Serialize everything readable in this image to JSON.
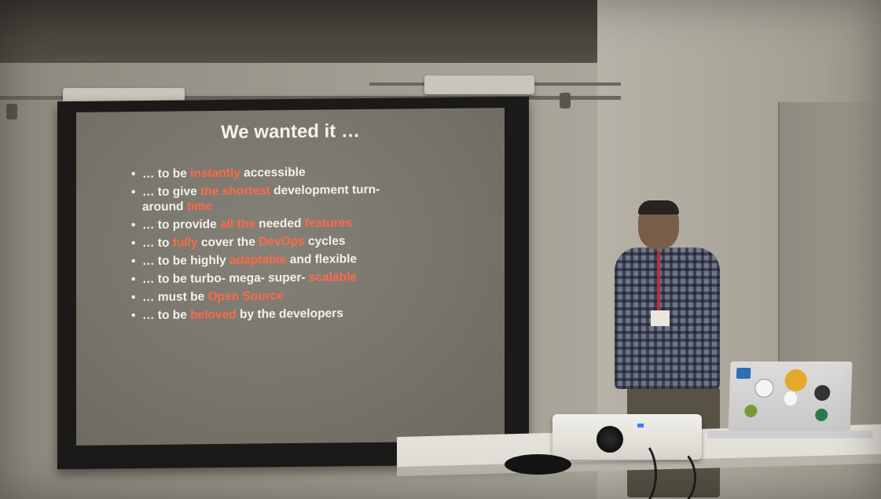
{
  "slide": {
    "title": "We wanted it …",
    "bullets": [
      {
        "parts": [
          "… to be ",
          "instantly",
          " accessible"
        ]
      },
      {
        "parts": [
          "… to give ",
          "the shortest",
          " development turn-around ",
          "time"
        ]
      },
      {
        "parts": [
          "… to provide ",
          "all the",
          " needed ",
          "features"
        ]
      },
      {
        "parts": [
          "… to ",
          "fully",
          " cover the ",
          "DevOps",
          " cycles"
        ]
      },
      {
        "parts": [
          "… to be highly ",
          "adaptable",
          " and flexible"
        ]
      },
      {
        "parts": [
          "… to be turbo- mega- super- ",
          "scalable"
        ]
      },
      {
        "parts": [
          "… must be ",
          "Open Source"
        ]
      },
      {
        "parts": [
          "… to be ",
          "beloved",
          " by the developers"
        ]
      }
    ]
  },
  "colors": {
    "highlight": "#ff6a4a",
    "slide_text": "#f4f1ea",
    "slide_background": "#7a776e"
  },
  "scene_objects": [
    "projection-screen",
    "presenter",
    "projector",
    "laptop",
    "mouse",
    "table"
  ]
}
